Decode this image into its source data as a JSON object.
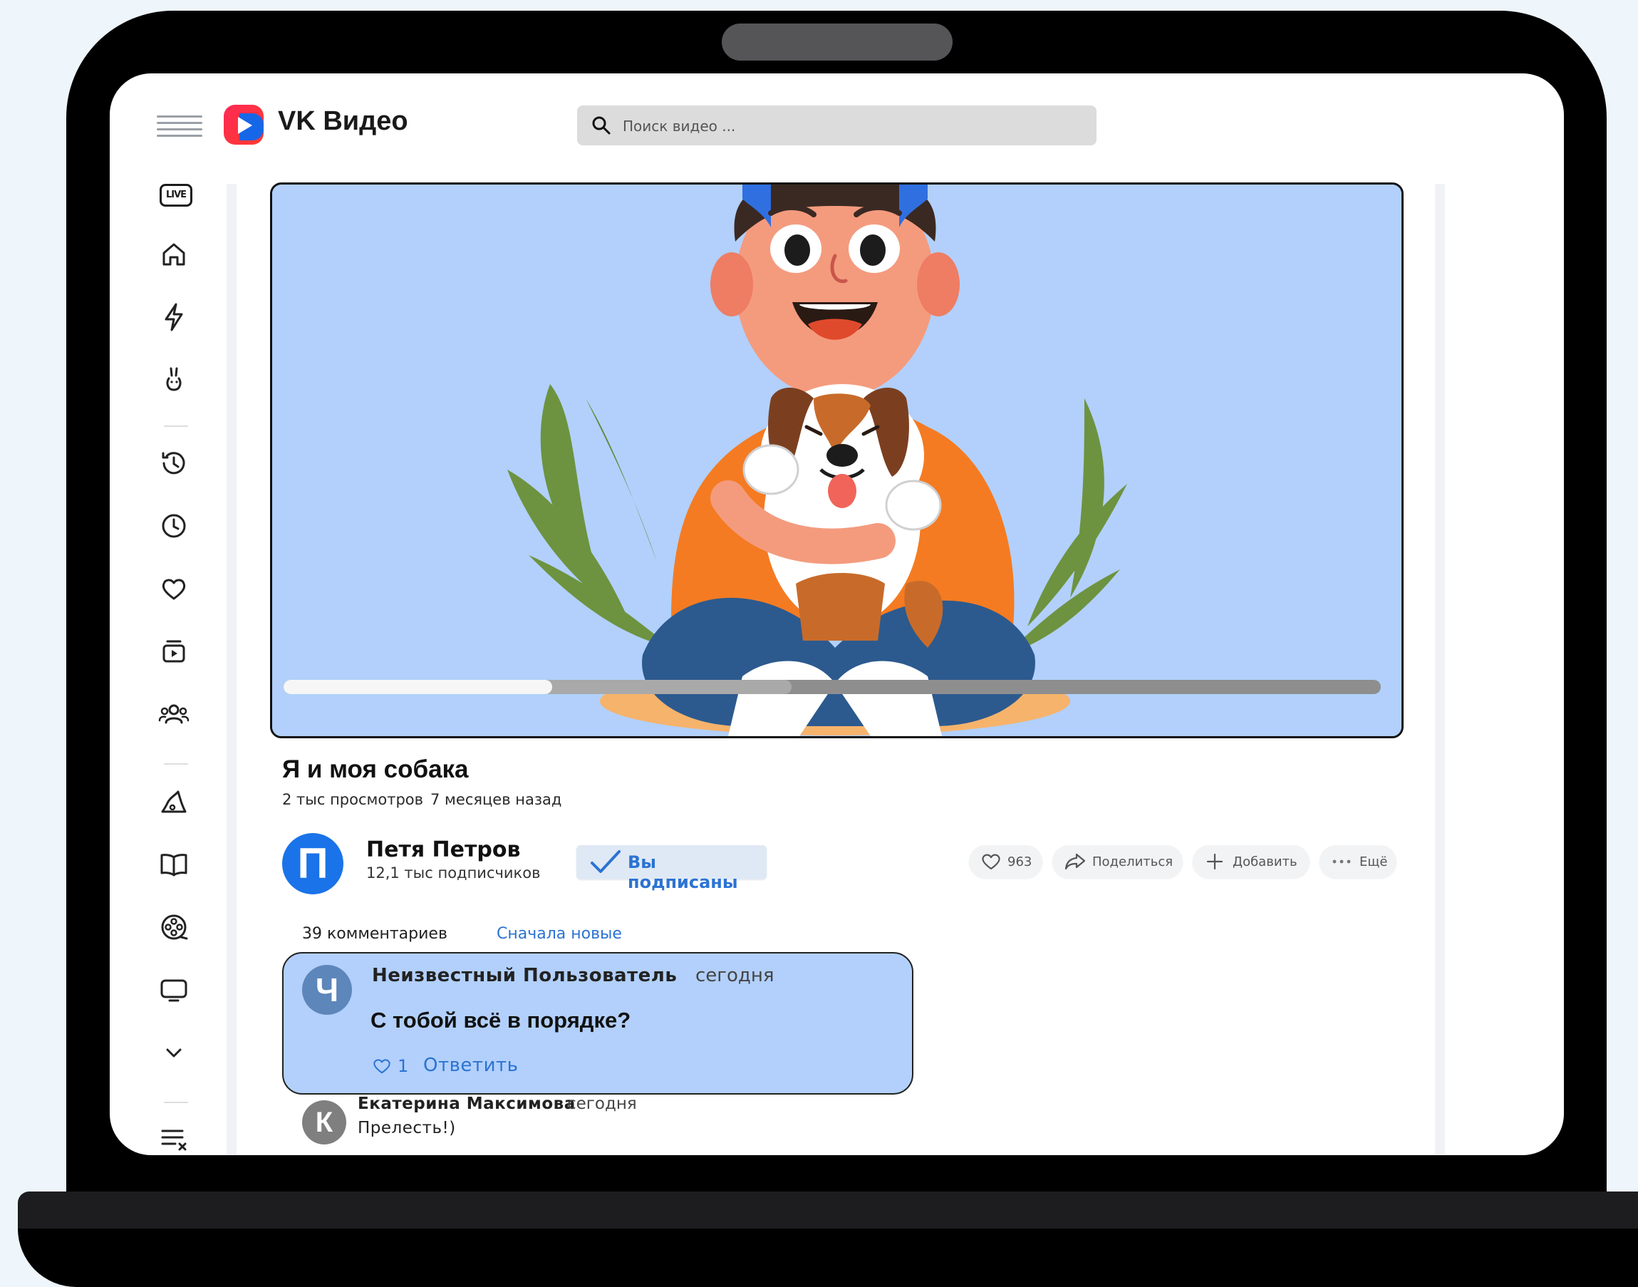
{
  "app": {
    "logo_text": "VK Видео",
    "brand_color": "#ff2a55",
    "accent_color": "#2c73d2"
  },
  "search": {
    "placeholder": "Поиск видео ..."
  },
  "sidebar": {
    "items": [
      {
        "icon": "live-icon",
        "label": "LIVE"
      },
      {
        "icon": "home-icon"
      },
      {
        "icon": "lightning-icon"
      },
      {
        "icon": "hand-emoji-icon"
      },
      {
        "icon": "history-icon"
      },
      {
        "icon": "clock-icon"
      },
      {
        "icon": "heart-icon"
      },
      {
        "icon": "video-library-icon"
      },
      {
        "icon": "users-icon"
      },
      {
        "icon": "magic-hat-icon"
      },
      {
        "icon": "book-icon"
      },
      {
        "icon": "film-reel-icon"
      },
      {
        "icon": "tv-icon"
      },
      {
        "icon": "chevron-down-icon"
      },
      {
        "icon": "list-close-icon"
      }
    ]
  },
  "video": {
    "title": "Я и моя собака",
    "views": "2 тыс просмотров",
    "published": "7 месяцев назад",
    "progress": 0.245,
    "buffered": 0.463
  },
  "channel": {
    "avatar_letter": "П",
    "name": "Петя Петров",
    "subscribers": "12,1 тыс подписчиков",
    "subscribed_label": "Вы подписаны"
  },
  "actions": {
    "likes": "963",
    "share": "Поделиться",
    "add": "Добавить",
    "more": "Ещё"
  },
  "comments": {
    "count_label": "39 комментариев",
    "sort_label": "Сначала новые",
    "items": [
      {
        "avatar_letter": "Ч",
        "avatar_color": "#5d86ba",
        "author": "Неизвестный Пользователь",
        "time": "сегодня",
        "text": "С тобой всё в порядке?",
        "likes": "1",
        "reply_label": "Ответить"
      },
      {
        "avatar_letter": "К",
        "avatar_color": "#7f7f7f",
        "author": "Екатерина Максимова",
        "time": "сегодня",
        "text": "Прелесть!)"
      }
    ]
  }
}
